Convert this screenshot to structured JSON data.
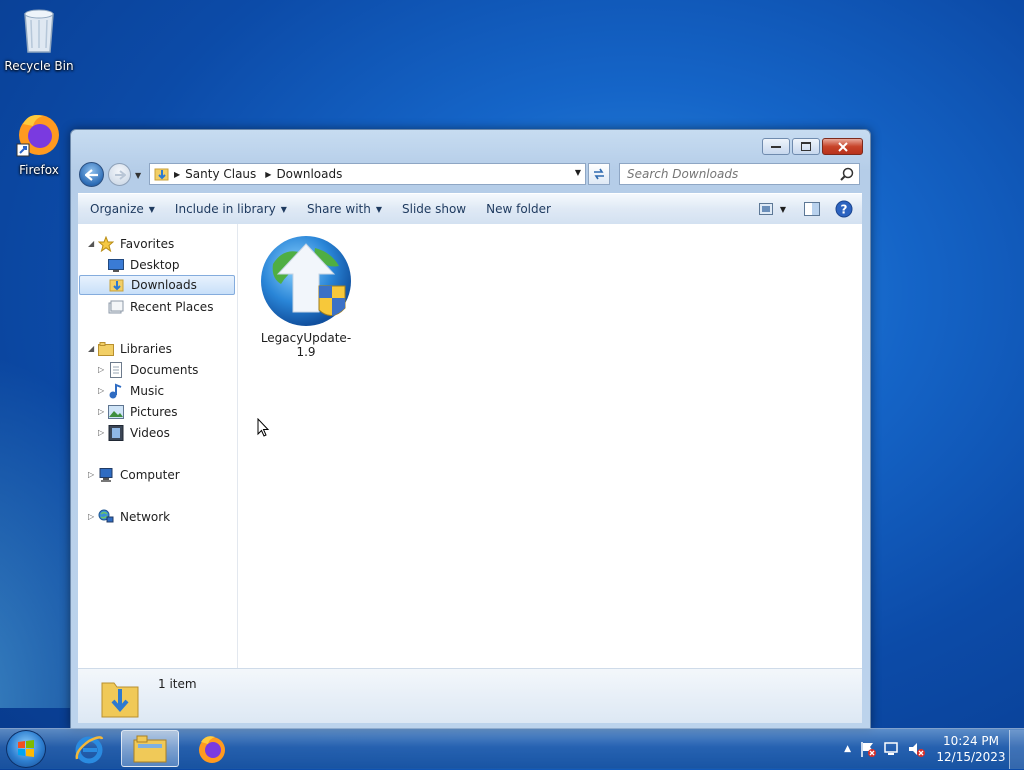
{
  "desktop": {
    "icons": [
      {
        "label": "Recycle Bin",
        "icon": "recycle-bin-icon"
      },
      {
        "label": "Firefox",
        "icon": "firefox-icon"
      }
    ]
  },
  "window": {
    "title_buttons": [
      "minimize",
      "maximize",
      "close"
    ],
    "address": {
      "segments": [
        "Santy Claus",
        "Downloads"
      ]
    },
    "search": {
      "placeholder": "Search Downloads"
    },
    "toolbar": {
      "organize": "Organize",
      "include_in_library": "Include in library",
      "share_with": "Share with",
      "slide_show": "Slide show",
      "new_folder": "New folder"
    },
    "nav_pane": {
      "favorites": {
        "label": "Favorites",
        "items": [
          "Desktop",
          "Downloads",
          "Recent Places"
        ]
      },
      "libraries": {
        "label": "Libraries",
        "items": [
          "Documents",
          "Music",
          "Pictures",
          "Videos"
        ]
      },
      "computer": "Computer",
      "network": "Network",
      "selected": "Downloads"
    },
    "files": [
      {
        "name": "LegacyUpdate-1.9",
        "icon": "legacy-update-globe-icon"
      }
    ],
    "details": {
      "count": "1 item"
    }
  },
  "taskbar": {
    "apps": [
      "start-orb",
      "internet-explorer",
      "windows-explorer",
      "firefox"
    ],
    "active": "windows-explorer",
    "clock": {
      "time": "10:24 PM",
      "date": "12/15/2023"
    }
  },
  "colors": {
    "selection": "#c8e0f9",
    "accent": "#2e6db6"
  }
}
